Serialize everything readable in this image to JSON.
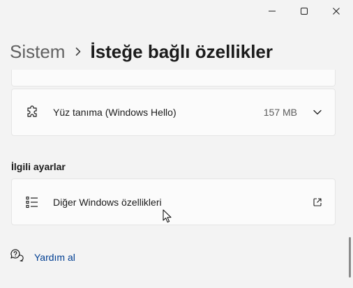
{
  "window": {
    "controls": [
      "minimize-icon",
      "maximize-icon",
      "close-icon"
    ]
  },
  "breadcrumb": {
    "parent": "Sistem",
    "current": "İsteğe bağlı özellikler"
  },
  "features": [
    {
      "label": "Yüz tanıma (Windows Hello)",
      "size": "157 MB",
      "icon": "puzzle-icon"
    }
  ],
  "related": {
    "title": "İlgili ayarlar",
    "items": [
      {
        "label": "Diğer Windows özellikleri",
        "icon": "list-icon",
        "action_icon": "open-external-icon"
      }
    ]
  },
  "help": {
    "label": "Yardım al",
    "icon": "help-chat-icon"
  },
  "colors": {
    "background": "#f3f3f3",
    "card": "#fbfbfb",
    "link": "#003e92"
  }
}
